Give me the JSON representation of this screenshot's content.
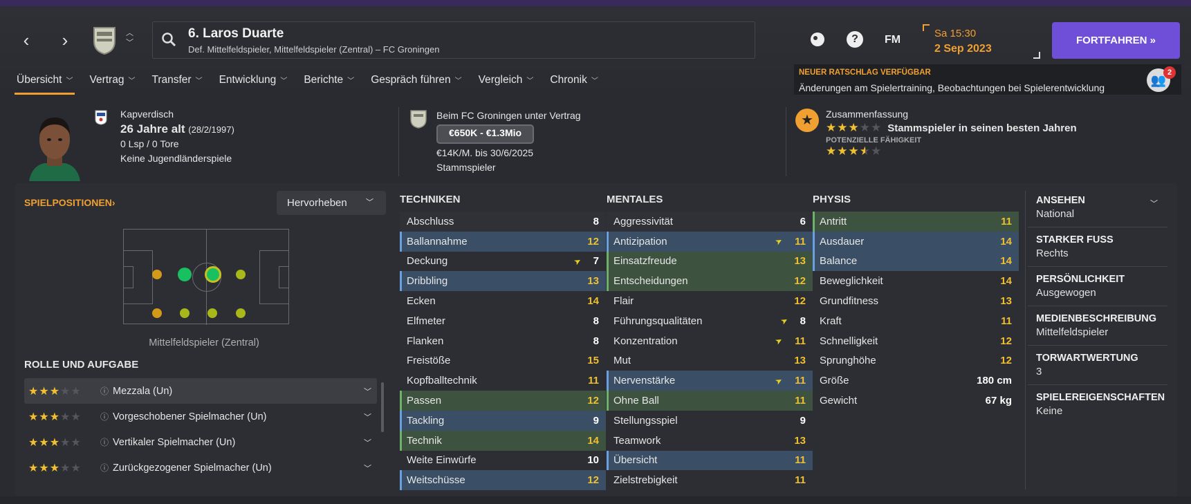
{
  "header": {
    "player_name": "6. Laros Duarte",
    "player_sub": "Def. Mittelfeldspieler, Mittelfeldspieler (Zentral) – FC Groningen",
    "time": "Sa 15:30",
    "date": "2 Sep 2023",
    "continue_label": "FORTFAHREN",
    "fm_label": "FM",
    "help_label": "?",
    "advice_heading": "NEUER RATSCHLAG VERFÜGBAR",
    "advice_text": "Änderungen am Spielertraining, Beobachtungen bei Spielerentwicklung",
    "advice_count": "2"
  },
  "tabs": [
    {
      "label": "Übersicht"
    },
    {
      "label": "Vertrag"
    },
    {
      "label": "Transfer"
    },
    {
      "label": "Entwicklung"
    },
    {
      "label": "Berichte"
    },
    {
      "label": "Gespräch führen"
    },
    {
      "label": "Vergleich"
    },
    {
      "label": "Chronik"
    }
  ],
  "summary": {
    "nationality": "Kapverdisch",
    "age": "26 Jahre alt",
    "birth": "(28/2/1997)",
    "caps": "0 Lsp / 0 Tore",
    "youth": "Keine Jugendländerspiele",
    "contract_head": "Beim FC Groningen unter Vertrag",
    "value": "€650K - €1.3Mio",
    "wage": "€14K/M. bis 30/6/2025",
    "status": "Stammspieler",
    "zus_head": "Zusammenfassung",
    "role_desc": "Stammspieler in seinen besten Jahren",
    "pot_label": "POTENZIELLE FÄHIGKEIT",
    "current_stars": 3,
    "potential_stars": 3.5
  },
  "positions": {
    "heading": "SPIELPOSITIONEN",
    "highlight": "Hervorheben",
    "label": "Mittelfeldspieler (Zentral)"
  },
  "roles": {
    "heading": "ROLLE UND AUFGABE",
    "items": [
      {
        "name": "Mezzala (Un)",
        "stars": 3
      },
      {
        "name": "Vorgeschobener Spielmacher (Un)",
        "stars": 3
      },
      {
        "name": "Vertikaler Spielmacher (Un)",
        "stars": 3
      },
      {
        "name": "Zurückgezogener Spielmacher (Un)",
        "stars": 3
      }
    ]
  },
  "technik": {
    "heading": "TECHNIKEN",
    "items": [
      {
        "n": "Abschluss",
        "v": "8",
        "s": "alt"
      },
      {
        "n": "Ballannahme",
        "v": "12",
        "s": "blue"
      },
      {
        "n": "Deckung",
        "v": "7",
        "s": "",
        "arrow": true
      },
      {
        "n": "Dribbling",
        "v": "13",
        "s": "blue"
      },
      {
        "n": "Ecken",
        "v": "14",
        "s": ""
      },
      {
        "n": "Elfmeter",
        "v": "8",
        "s": ""
      },
      {
        "n": "Flanken",
        "v": "8",
        "s": ""
      },
      {
        "n": "Freistöße",
        "v": "15",
        "s": ""
      },
      {
        "n": "Kopfballtechnik",
        "v": "11",
        "s": ""
      },
      {
        "n": "Passen",
        "v": "12",
        "s": "green"
      },
      {
        "n": "Tackling",
        "v": "9",
        "s": "blue"
      },
      {
        "n": "Technik",
        "v": "14",
        "s": "green"
      },
      {
        "n": "Weite Einwürfe",
        "v": "10",
        "s": ""
      },
      {
        "n": "Weitschüsse",
        "v": "12",
        "s": "blue"
      }
    ]
  },
  "mental": {
    "heading": "MENTALES",
    "items": [
      {
        "n": "Aggressivität",
        "v": "6",
        "s": "alt"
      },
      {
        "n": "Antizipation",
        "v": "11",
        "s": "blue",
        "arrow": true
      },
      {
        "n": "Einsatzfreude",
        "v": "13",
        "s": "green"
      },
      {
        "n": "Entscheidungen",
        "v": "12",
        "s": "green"
      },
      {
        "n": "Flair",
        "v": "12",
        "s": ""
      },
      {
        "n": "Führungsqualitäten",
        "v": "8",
        "s": "",
        "arrow": true
      },
      {
        "n": "Konzentration",
        "v": "11",
        "s": "",
        "arrow": true
      },
      {
        "n": "Mut",
        "v": "13",
        "s": ""
      },
      {
        "n": "Nervenstärke",
        "v": "11",
        "s": "blue",
        "arrow": true
      },
      {
        "n": "Ohne Ball",
        "v": "11",
        "s": "green"
      },
      {
        "n": "Stellungsspiel",
        "v": "9",
        "s": ""
      },
      {
        "n": "Teamwork",
        "v": "13",
        "s": ""
      },
      {
        "n": "Übersicht",
        "v": "11",
        "s": "blue"
      },
      {
        "n": "Zielstrebigkeit",
        "v": "11",
        "s": ""
      }
    ]
  },
  "physis": {
    "heading": "PHYSIS",
    "items": [
      {
        "n": "Antritt",
        "v": "11",
        "s": "green"
      },
      {
        "n": "Ausdauer",
        "v": "14",
        "s": "blue"
      },
      {
        "n": "Balance",
        "v": "14",
        "s": "blue"
      },
      {
        "n": "Beweglichkeit",
        "v": "14",
        "s": ""
      },
      {
        "n": "Grundfitness",
        "v": "13",
        "s": ""
      },
      {
        "n": "Kraft",
        "v": "11",
        "s": ""
      },
      {
        "n": "Schnelligkeit",
        "v": "12",
        "s": ""
      },
      {
        "n": "Sprunghöhe",
        "v": "12",
        "s": ""
      }
    ],
    "height_label": "Größe",
    "height": "180 cm",
    "weight_label": "Gewicht",
    "weight": "67 kg"
  },
  "side": {
    "items": [
      {
        "k": "ANSEHEN",
        "v": "National"
      },
      {
        "k": "STARKER FUSS",
        "v": "Rechts"
      },
      {
        "k": "PERSÖNLICHKEIT",
        "v": "Ausgewogen"
      },
      {
        "k": "MEDIENBESCHREIBUNG",
        "v": "Mittelfeldspieler"
      },
      {
        "k": "TORWARTWERTUNG",
        "v": "3"
      },
      {
        "k": "SPIELEREIGENSCHAFTEN",
        "v": "Keine"
      }
    ]
  },
  "colors": {
    "accent": "#f0a030",
    "button": "#6f4fd8",
    "star": "#f0c030"
  }
}
